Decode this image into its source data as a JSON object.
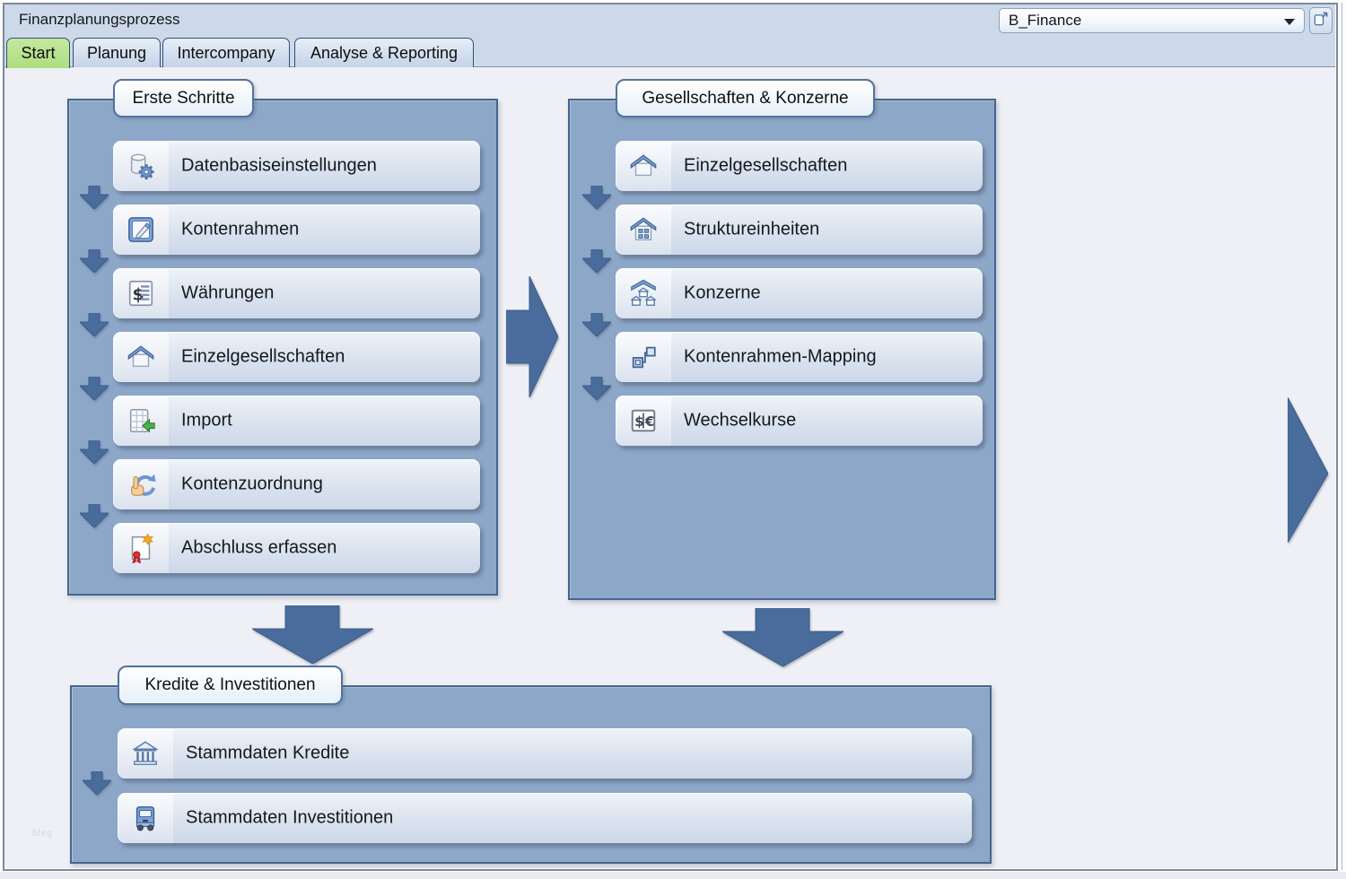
{
  "window": {
    "title": "Finanzplanungsprozess"
  },
  "toolbar": {
    "selector_value": "B_Finance"
  },
  "tabs": [
    {
      "label": "Start",
      "active": true
    },
    {
      "label": "Planung",
      "active": false
    },
    {
      "label": "Intercompany",
      "active": false
    },
    {
      "label": "Analyse & Reporting",
      "active": false
    }
  ],
  "panels": [
    {
      "title": "Erste Schritte",
      "buttons": [
        {
          "label": "Datenbasiseinstellungen",
          "icon": "database-gear-icon"
        },
        {
          "label": "Kontenrahmen",
          "icon": "notepad-pencil-icon"
        },
        {
          "label": "Währungen",
          "icon": "currency-list-icon"
        },
        {
          "label": "Einzelgesellschaften",
          "icon": "house-icon"
        },
        {
          "label": "Import",
          "icon": "table-import-icon"
        },
        {
          "label": "Kontenzuordnung",
          "icon": "hand-sync-icon"
        },
        {
          "label": "Abschluss erfassen",
          "icon": "certificate-icon"
        }
      ]
    },
    {
      "title": "Gesellschaften & Konzerne",
      "buttons": [
        {
          "label": "Einzelgesellschaften",
          "icon": "house-icon"
        },
        {
          "label": "Struktureinheiten",
          "icon": "building-windows-icon"
        },
        {
          "label": "Konzerne",
          "icon": "group-houses-icon"
        },
        {
          "label": "Kontenrahmen-Mapping",
          "icon": "mapping-squares-icon"
        },
        {
          "label": "Wechselkurse",
          "icon": "dollar-euro-icon"
        }
      ]
    },
    {
      "title": "Kredite & Investitionen",
      "buttons": [
        {
          "label": "Stammdaten Kredite",
          "icon": "bank-icon"
        },
        {
          "label": "Stammdaten Investitionen",
          "icon": "truck-icon"
        }
      ]
    }
  ],
  "watermark": "bleg",
  "colors": {
    "titlebar": "#cdd9e9",
    "content_bg": "#eef0f5",
    "panel_bg": "#8da7c9",
    "panel_border": "#44658f",
    "arrow": "#4a6c9c",
    "tab_active": "#b7e18e"
  }
}
